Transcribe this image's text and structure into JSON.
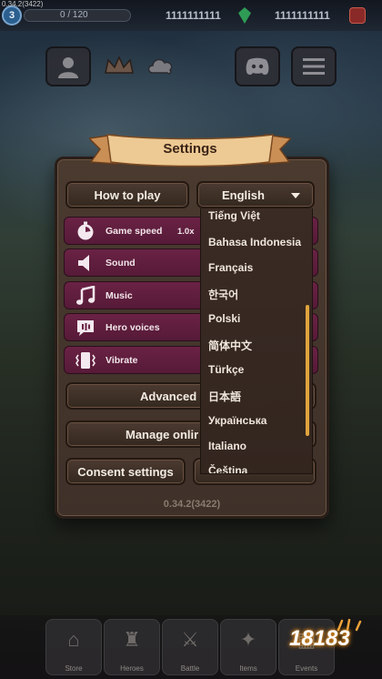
{
  "version_corner": "0.34.2(3422)",
  "topbar": {
    "level": "3",
    "xp": "0 / 120",
    "gems": "1111111111",
    "gold": "1111111111",
    "gem_icon": "gem-icon",
    "ruby_icon": "ruby-icon"
  },
  "settings": {
    "title": "Settings",
    "how_to_play": "How to play",
    "language_selected": "English",
    "rows": [
      {
        "label": "Game speed",
        "value": "1.0x",
        "icon": "stopwatch-icon"
      },
      {
        "label": "Sound",
        "value": "",
        "icon": "speaker-icon"
      },
      {
        "label": "Music",
        "value": "",
        "icon": "music-note-icon"
      },
      {
        "label": "Hero voices",
        "value": "",
        "icon": "speech-bubble-icon"
      },
      {
        "label": "Vibrate",
        "value": "",
        "icon": "vibrate-icon"
      }
    ],
    "advanced": "Advanced s",
    "manage": "Manage onlir",
    "consent": "Consent settings",
    "version": "0.34.2(3422)"
  },
  "language_dropdown": {
    "options": [
      "Tiếng Việt",
      "Bahasa Indonesia",
      "Français",
      "한국어",
      "Polski",
      "简体中文",
      "Türkçe",
      "日本語",
      "Українська",
      "Italiano",
      "Čeština"
    ]
  },
  "bottom_nav": [
    {
      "label": "Store"
    },
    {
      "label": "Heroes"
    },
    {
      "label": "Battle"
    },
    {
      "label": "Items"
    },
    {
      "label": "Events"
    }
  ],
  "watermark": "18183",
  "colors": {
    "panel": "#3f3129",
    "purple_row": "#6a2244",
    "scrollbar": "#e0a43c",
    "ribbon": "#e7c08a"
  }
}
